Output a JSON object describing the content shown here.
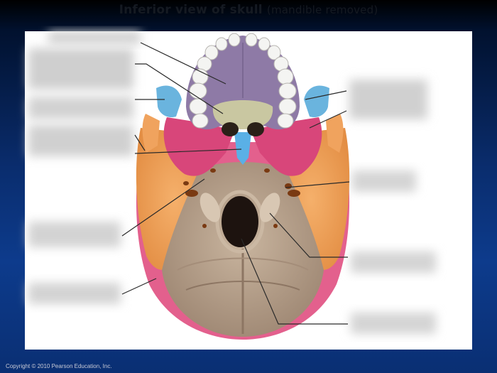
{
  "header": {
    "title": "Inferior view of skull",
    "subtitle": "(mandible removed)"
  },
  "footer": {
    "copyright": "Copyright © 2010 Pearson Education, Inc."
  },
  "colors": {
    "maxilla": "#8e7aa6",
    "palatine": "#c9c7a1",
    "sphenoid": "#d8467a",
    "zygomatic": "#6ab4de",
    "vomer": "#5ab0e6",
    "temporal": "#f0a35e",
    "occipital": "#b29c86",
    "parietal": "#e3608d",
    "teeth": "#f4f4f2"
  },
  "labels": {
    "left": [
      "",
      "",
      "",
      "",
      "",
      ""
    ],
    "right": [
      "",
      "",
      "",
      "",
      ""
    ]
  }
}
